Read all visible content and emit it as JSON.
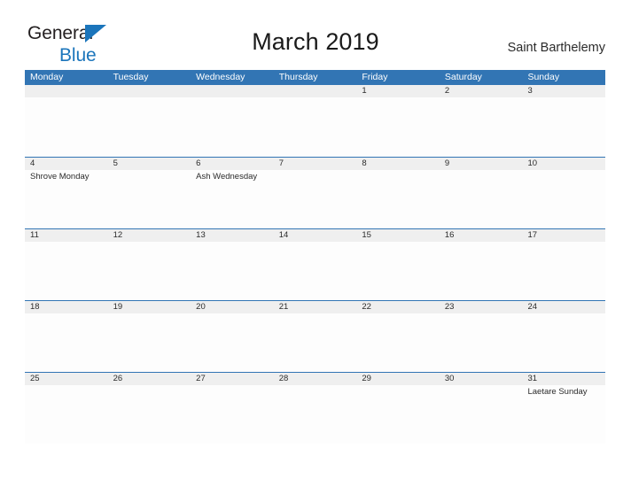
{
  "brand": {
    "name_top": "General",
    "name_bottom": "Blue",
    "mark": "triangle-logo-mark",
    "color_dark": "#231f20",
    "color_blue": "#1b75bb"
  },
  "header": {
    "title": "March 2019",
    "location": "Saint Barthelemy"
  },
  "calendar": {
    "accent_color": "#3275b4",
    "date_band_color": "#efefef",
    "weekdays": [
      "Monday",
      "Tuesday",
      "Wednesday",
      "Thursday",
      "Friday",
      "Saturday",
      "Sunday"
    ],
    "weeks": [
      [
        {
          "day": "",
          "events": []
        },
        {
          "day": "",
          "events": []
        },
        {
          "day": "",
          "events": []
        },
        {
          "day": "",
          "events": []
        },
        {
          "day": "1",
          "events": []
        },
        {
          "day": "2",
          "events": []
        },
        {
          "day": "3",
          "events": []
        }
      ],
      [
        {
          "day": "4",
          "events": [
            "Shrove Monday"
          ]
        },
        {
          "day": "5",
          "events": []
        },
        {
          "day": "6",
          "events": [
            "Ash Wednesday"
          ]
        },
        {
          "day": "7",
          "events": []
        },
        {
          "day": "8",
          "events": []
        },
        {
          "day": "9",
          "events": []
        },
        {
          "day": "10",
          "events": []
        }
      ],
      [
        {
          "day": "11",
          "events": []
        },
        {
          "day": "12",
          "events": []
        },
        {
          "day": "13",
          "events": []
        },
        {
          "day": "14",
          "events": []
        },
        {
          "day": "15",
          "events": []
        },
        {
          "day": "16",
          "events": []
        },
        {
          "day": "17",
          "events": []
        }
      ],
      [
        {
          "day": "18",
          "events": []
        },
        {
          "day": "19",
          "events": []
        },
        {
          "day": "20",
          "events": []
        },
        {
          "day": "21",
          "events": []
        },
        {
          "day": "22",
          "events": []
        },
        {
          "day": "23",
          "events": []
        },
        {
          "day": "24",
          "events": []
        }
      ],
      [
        {
          "day": "25",
          "events": []
        },
        {
          "day": "26",
          "events": []
        },
        {
          "day": "27",
          "events": []
        },
        {
          "day": "28",
          "events": []
        },
        {
          "day": "29",
          "events": []
        },
        {
          "day": "30",
          "events": []
        },
        {
          "day": "31",
          "events": [
            "Laetare Sunday"
          ]
        }
      ]
    ]
  }
}
